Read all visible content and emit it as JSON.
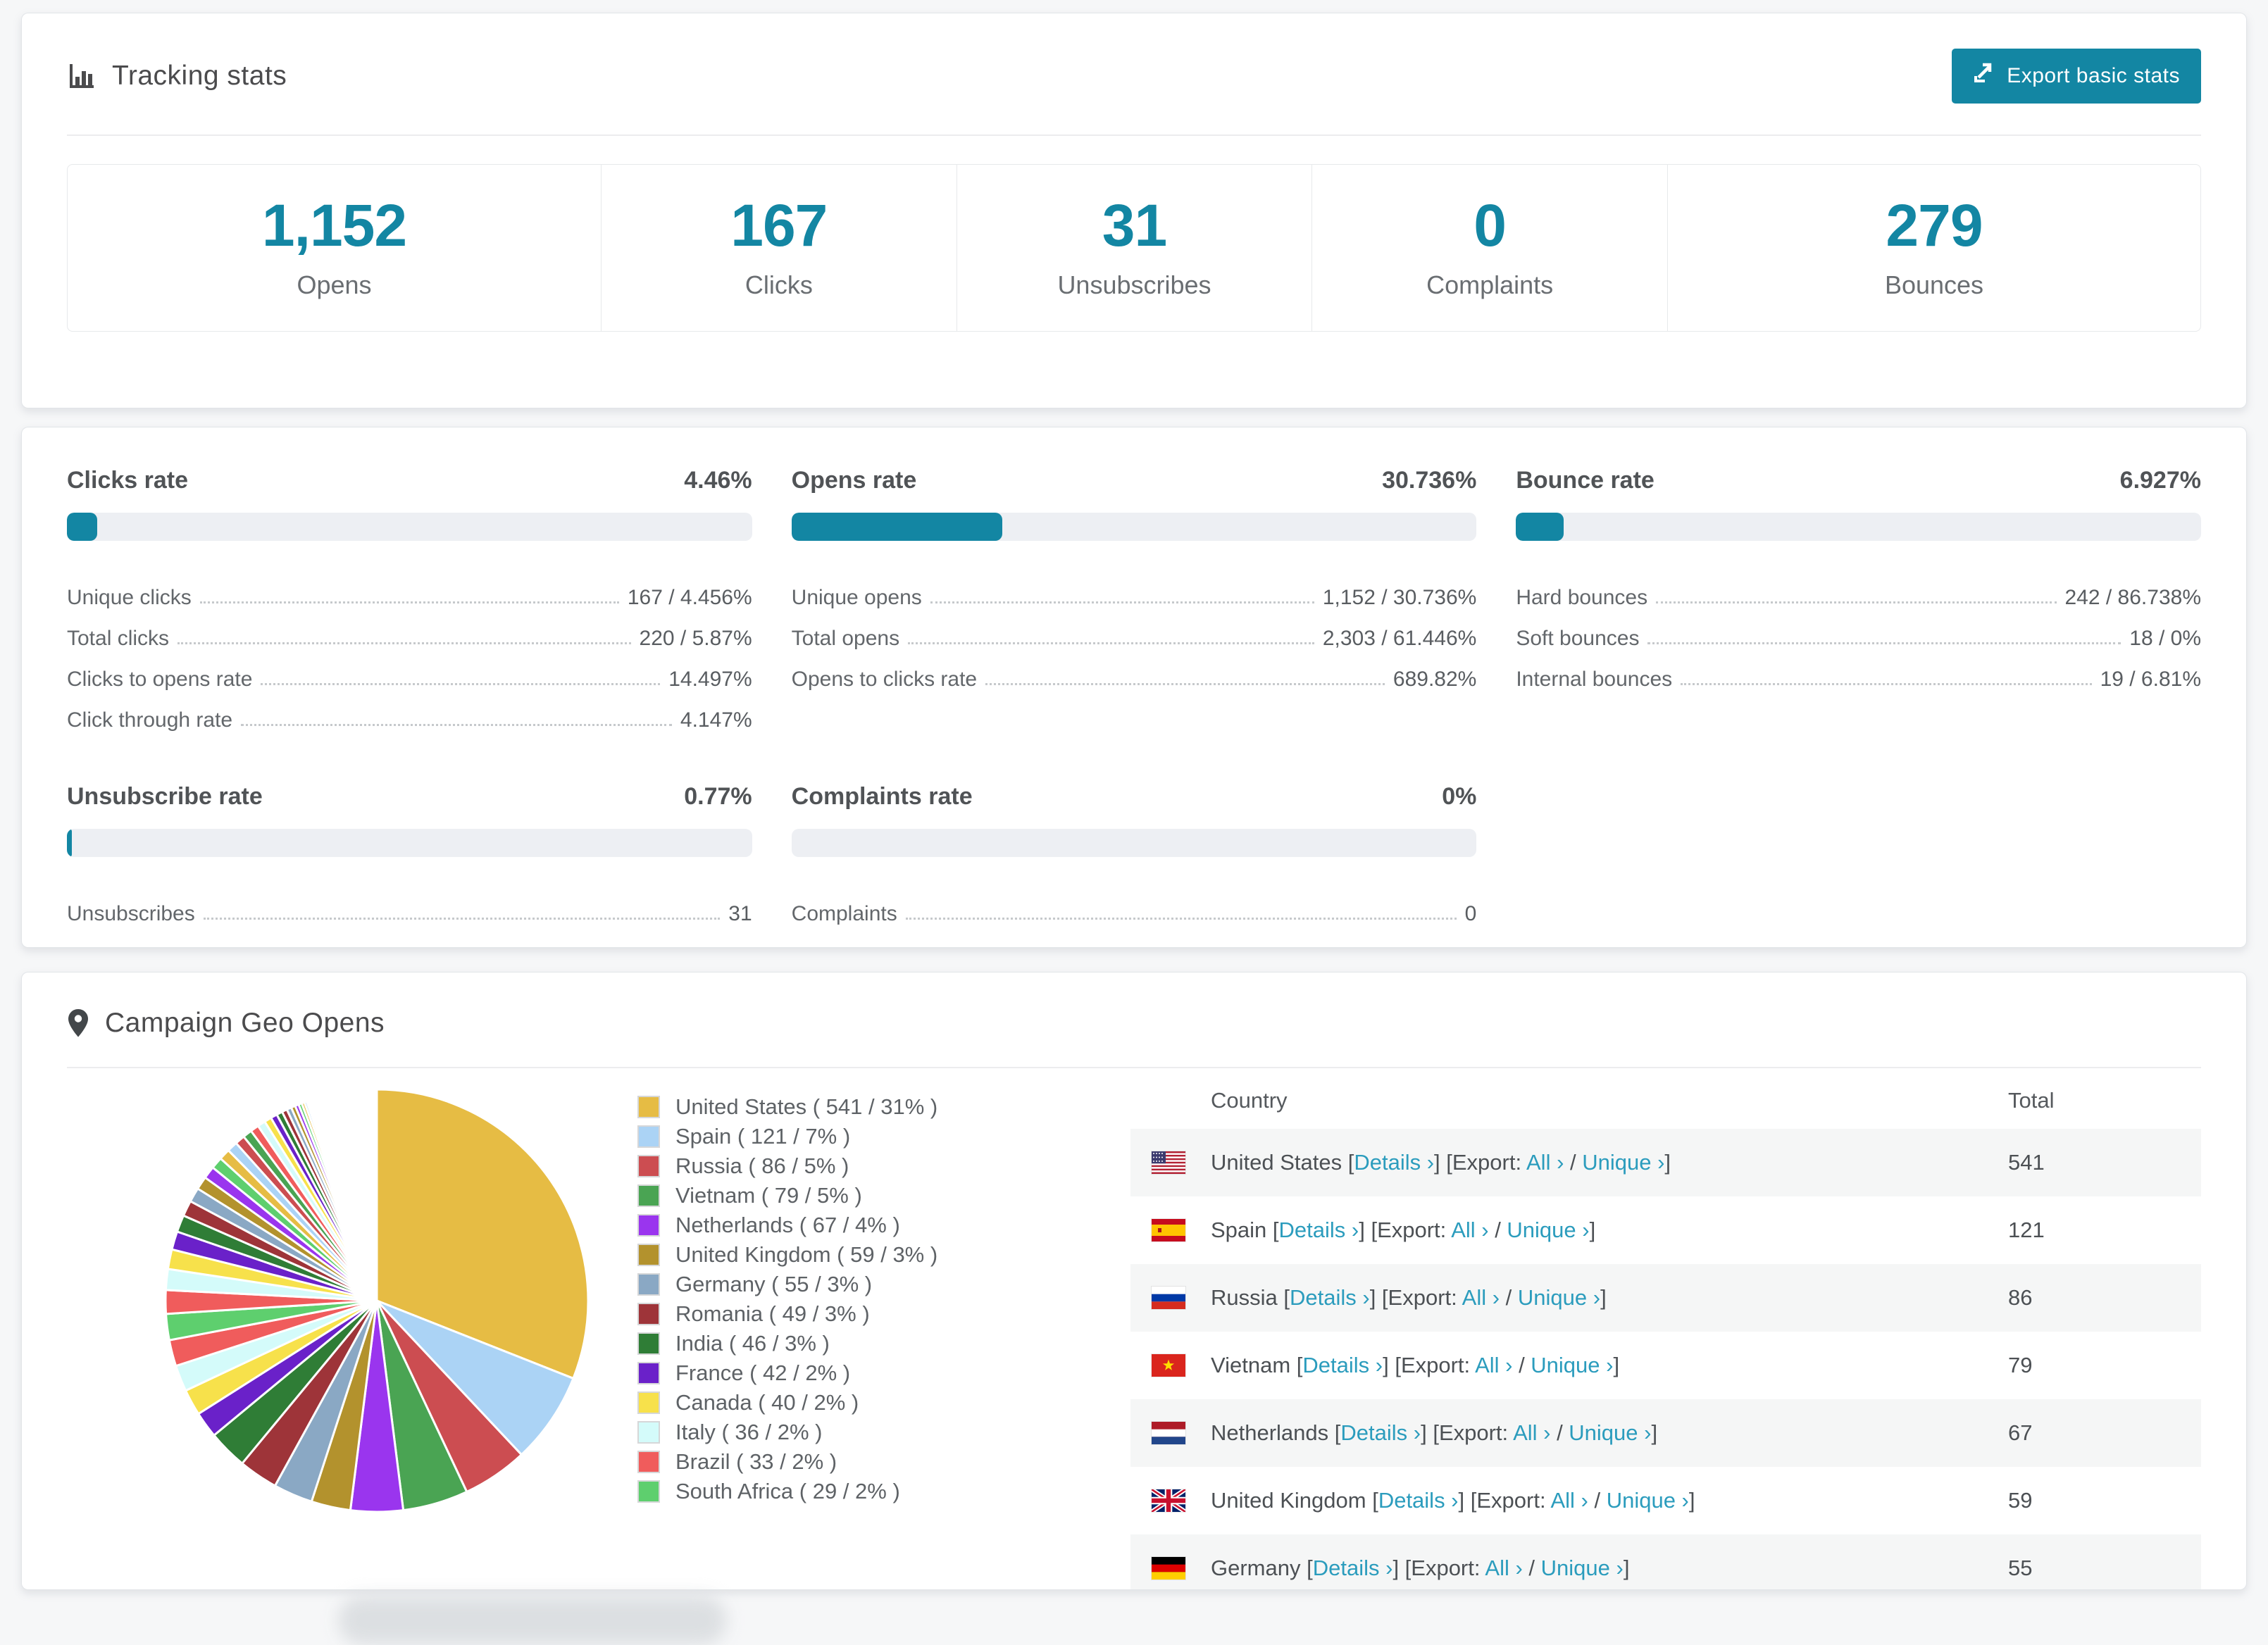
{
  "colors": {
    "accent": "#1386a3",
    "link": "#2b9cbd",
    "bar_track": "#edeff3",
    "row_alt": "#f5f6f6"
  },
  "tracking": {
    "title": "Tracking stats",
    "export_button": "Export basic stats",
    "stats": [
      {
        "value": "1,152",
        "label": "Opens"
      },
      {
        "value": "167",
        "label": "Clicks"
      },
      {
        "value": "31",
        "label": "Unsubscribes"
      },
      {
        "value": "0",
        "label": "Complaints"
      },
      {
        "value": "279",
        "label": "Bounces"
      }
    ]
  },
  "rates": [
    {
      "title": "Clicks rate",
      "value": "4.46%",
      "percent": 4.46,
      "rows": [
        {
          "label": "Unique clicks",
          "value": "167 / 4.456%"
        },
        {
          "label": "Total clicks",
          "value": "220 / 5.87%"
        },
        {
          "label": "Clicks to opens rate",
          "value": "14.497%"
        },
        {
          "label": "Click through rate",
          "value": "4.147%"
        }
      ]
    },
    {
      "title": "Opens rate",
      "value": "30.736%",
      "percent": 30.736,
      "rows": [
        {
          "label": "Unique opens",
          "value": "1,152 / 30.736%"
        },
        {
          "label": "Total opens",
          "value": "2,303 / 61.446%"
        },
        {
          "label": "Opens to clicks rate",
          "value": "689.82%"
        }
      ]
    },
    {
      "title": "Bounce rate",
      "value": "6.927%",
      "percent": 6.927,
      "rows": [
        {
          "label": "Hard bounces",
          "value": "242 / 86.738%"
        },
        {
          "label": "Soft bounces",
          "value": "18 / 0%"
        },
        {
          "label": "Internal bounces",
          "value": "19 / 6.81%"
        }
      ]
    },
    {
      "title": "Unsubscribe rate",
      "value": "0.77%",
      "percent": 0.77,
      "rows": [
        {
          "label": "Unsubscribes",
          "value": "31"
        }
      ]
    },
    {
      "title": "Complaints rate",
      "value": "0%",
      "percent": 0,
      "rows": [
        {
          "label": "Complaints",
          "value": "0"
        }
      ]
    }
  ],
  "geo": {
    "title": "Campaign Geo Opens",
    "table": {
      "headers": {
        "country": "Country",
        "total": "Total"
      },
      "link_format": {
        "open_bracket": "[",
        "close_bracket": "]",
        "details": "Details ›",
        "export_prefix": "[Export:",
        "all": "All ›",
        "separator": "/",
        "unique": "Unique ›"
      },
      "rows": [
        {
          "country": "United States",
          "flag": "us",
          "total": "541"
        },
        {
          "country": "Spain",
          "flag": "es",
          "total": "121"
        },
        {
          "country": "Russia",
          "flag": "ru",
          "total": "86"
        },
        {
          "country": "Vietnam",
          "flag": "vn",
          "total": "79"
        },
        {
          "country": "Netherlands",
          "flag": "nl",
          "total": "67"
        },
        {
          "country": "United Kingdom",
          "flag": "gb",
          "total": "59"
        },
        {
          "country": "Germany",
          "flag": "de",
          "total": "55"
        }
      ]
    }
  },
  "chart_data": {
    "type": "pie",
    "title": "Campaign Geo Opens",
    "unit": "opens",
    "legend_position": "right",
    "start_angle_deg": -90,
    "direction": "clockwise",
    "slices": [
      {
        "name": "United States",
        "opens": 541,
        "percent": 31,
        "color": "#e6bc44",
        "legend_label": "United States ( 541 / 31% )"
      },
      {
        "name": "Spain",
        "opens": 121,
        "percent": 7,
        "color": "#abd3f5",
        "legend_label": "Spain ( 121 / 7% )"
      },
      {
        "name": "Russia",
        "opens": 86,
        "percent": 5,
        "color": "#cc4d51",
        "legend_label": "Russia ( 86 / 5% )"
      },
      {
        "name": "Vietnam",
        "opens": 79,
        "percent": 5,
        "color": "#4aa453",
        "legend_label": "Vietnam ( 79 / 5% )"
      },
      {
        "name": "Netherlands",
        "opens": 67,
        "percent": 4,
        "color": "#9a35ee",
        "legend_label": "Netherlands ( 67 / 4% )"
      },
      {
        "name": "United Kingdom",
        "opens": 59,
        "percent": 3,
        "color": "#b3922d",
        "legend_label": "United Kingdom ( 59 / 3% )"
      },
      {
        "name": "Germany",
        "opens": 55,
        "percent": 3,
        "color": "#8aa8c4",
        "legend_label": "Germany ( 55 / 3% )"
      },
      {
        "name": "Romania",
        "opens": 49,
        "percent": 3,
        "color": "#9e3439",
        "legend_label": "Romania ( 49 / 3% )"
      },
      {
        "name": "India",
        "opens": 46,
        "percent": 3,
        "color": "#2f7d36",
        "legend_label": "India ( 46 / 3% )"
      },
      {
        "name": "France",
        "opens": 42,
        "percent": 2,
        "color": "#6a21c9",
        "legend_label": "France ( 42 / 2% )"
      },
      {
        "name": "Canada",
        "opens": 40,
        "percent": 2,
        "color": "#f7e14b",
        "legend_label": "Canada ( 40 / 2% )"
      },
      {
        "name": "Italy",
        "opens": 36,
        "percent": 2,
        "color": "#d4fbfa",
        "legend_label": "Italy ( 36 / 2% )"
      },
      {
        "name": "Brazil",
        "opens": 33,
        "percent": 2,
        "color": "#f05c5c",
        "legend_label": "Brazil ( 33 / 2% )"
      },
      {
        "name": "South Africa",
        "opens": 29,
        "percent": 2,
        "color": "#5ecf6e",
        "legend_label": "South Africa ( 29 / 2% )"
      }
    ],
    "other_slices_percents": [
      1.8,
      1.6,
      1.5,
      1.4,
      1.3,
      1.2,
      1.1,
      1.0,
      0.95,
      0.9,
      0.85,
      0.8,
      0.75,
      0.7,
      0.65,
      0.6,
      0.55,
      0.5,
      0.45,
      0.4,
      0.36,
      0.32,
      0.28,
      0.25,
      0.22,
      0.19,
      0.16,
      0.14,
      0.12,
      0.1,
      0.09,
      0.08,
      0.07,
      0.06,
      0.05,
      0.05,
      0.04,
      0.04,
      0.03,
      0.03
    ],
    "other_slices_palette": [
      "#f05c5c",
      "#d4fbfa",
      "#f7e14b",
      "#6a21c9",
      "#2f7d36",
      "#9e3439",
      "#8aa8c4",
      "#b3922d",
      "#9a35ee",
      "#5ecf6e",
      "#e6bc44",
      "#abd3f5",
      "#cc4d51",
      "#4aa453"
    ]
  }
}
